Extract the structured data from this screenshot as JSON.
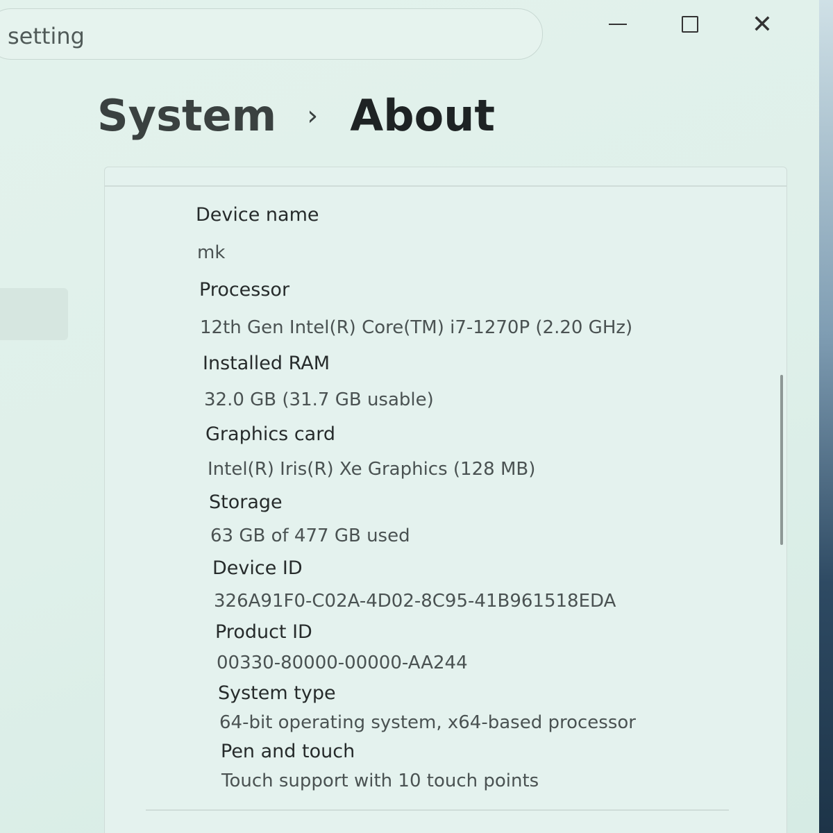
{
  "search": {
    "text": "setting"
  },
  "window_controls": {
    "minimize_icon": "minimize-icon",
    "maximize_icon": "maximize-icon",
    "close_icon": "close-icon",
    "close_glyph": "✕"
  },
  "breadcrumb": {
    "parent": "System",
    "separator": "›",
    "current": "About"
  },
  "specs": [
    {
      "label": "Device name",
      "value": "mk"
    },
    {
      "label": "Processor",
      "value": "12th Gen Intel(R) Core(TM) i7-1270P (2.20 GHz)"
    },
    {
      "label": "Installed RAM",
      "value": "32.0 GB (31.7 GB usable)"
    },
    {
      "label": "Graphics card",
      "value": "Intel(R) Iris(R) Xe Graphics (128 MB)"
    },
    {
      "label": "Storage",
      "value": "63 GB of 477 GB used"
    },
    {
      "label": "Device ID",
      "value": "326A91F0-C02A-4D02-8C95-41B961518EDA"
    },
    {
      "label": "Product ID",
      "value": "00330-80000-00000-AA244"
    },
    {
      "label": "System type",
      "value": "64-bit operating system, x64-based processor"
    },
    {
      "label": "Pen and touch",
      "value": "Touch support with 10 touch points"
    }
  ]
}
